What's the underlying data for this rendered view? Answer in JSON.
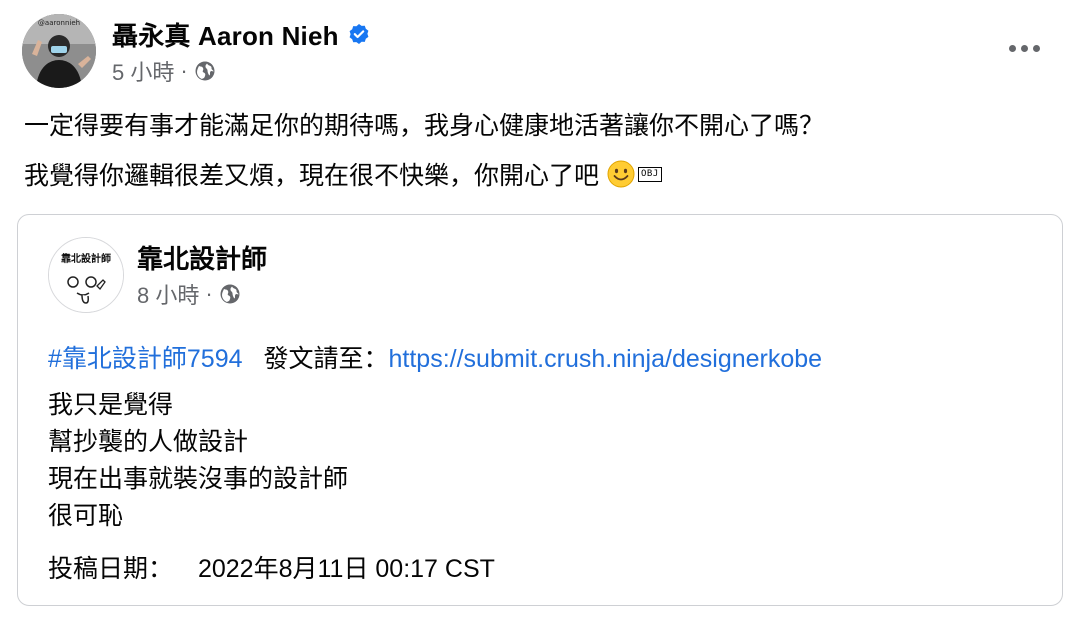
{
  "post": {
    "avatar_text": "@aaronnieh",
    "author_name": "聶永真 Aaron Nieh",
    "timestamp": "5 小時",
    "separator": "·",
    "text_line1": "一定得要有事才能滿足你的期待嗎，我身心健康地活著讓你不開心了嗎？",
    "text_line2": "我覺得你邏輯很差又煩，現在很不快樂，你開心了吧",
    "obj_glyph": "OBJ",
    "icons": {
      "verified": "verified-badge-icon",
      "audience": "globe-icon",
      "more": "more-options-icon",
      "emoji": "smiling-face-emoji"
    }
  },
  "shared": {
    "avatar_text": "靠北設計師",
    "page_name": "靠北設計師",
    "timestamp": "8 小時",
    "separator": "·",
    "hashtag": "#靠北設計師7594",
    "submit_label": "發文請至：",
    "submit_url": "https://submit.crush.ninja/designerkobe",
    "lines": [
      "我只是覺得",
      "幫抄襲的人做設計",
      "現在出事就裝沒事的設計師",
      "很可恥"
    ],
    "date_label": "投稿日期：",
    "date_value": "2022年8月11日 00:17 CST"
  },
  "colors": {
    "text": "#050505",
    "secondary": "#65676b",
    "link": "#216fdb",
    "verified": "#1877f2",
    "border": "#ced0d4"
  }
}
